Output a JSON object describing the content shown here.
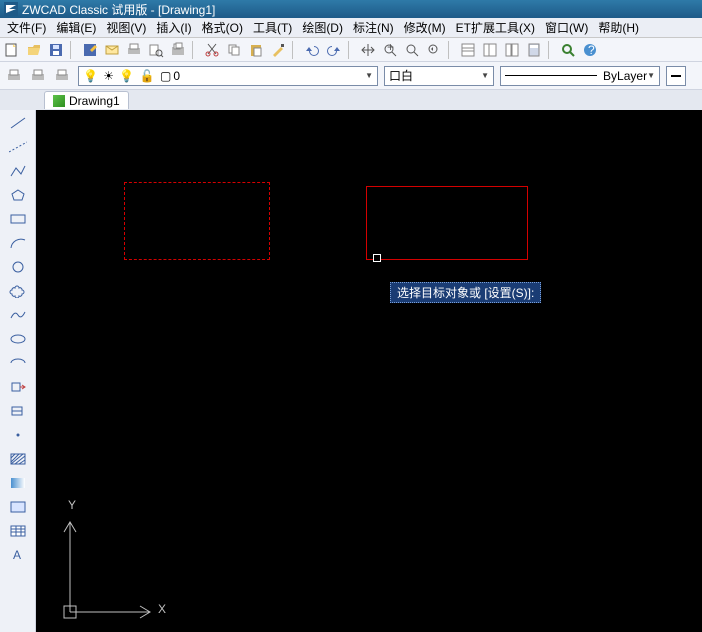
{
  "title": "ZWCAD Classic 试用版 - [Drawing1]",
  "menu": [
    "文件(F)",
    "编辑(E)",
    "视图(V)",
    "插入(I)",
    "格式(O)",
    "工具(T)",
    "绘图(D)",
    "标注(N)",
    "修改(M)",
    "ET扩展工具(X)",
    "窗口(W)",
    "帮助(H)"
  ],
  "tab": "Drawing1",
  "layer_name": "0",
  "color_name": "口白",
  "linetype_name": "ByLayer",
  "command_tip": "选择目标对象或 [设置(S)]:",
  "axis": {
    "x": "X",
    "y": "Y"
  }
}
